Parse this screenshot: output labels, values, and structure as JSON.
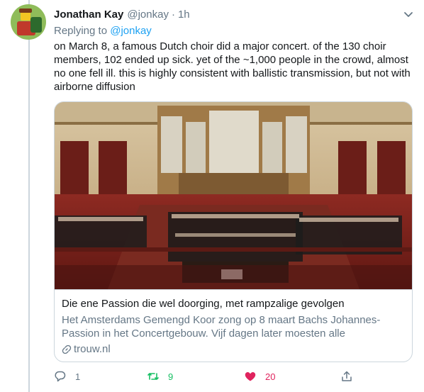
{
  "tweet": {
    "author_name": "Jonathan Kay",
    "author_handle": "@jonkay",
    "separator": "·",
    "time": "1h",
    "reply_prefix": "Replying to",
    "reply_to": "@jonkay",
    "text": "on March 8, a famous Dutch choir did a major concert. of the 130 choir members, 102 ended up sick. yet of the ~1,000 people in the crowd, almost no one fell ill. this is highly consistent with ballistic transmission, but not with airborne diffusion"
  },
  "card": {
    "title": "Die ene Passion die wel doorging, met rampzalige gevolgen",
    "description": "Het Amsterdams Gemengd Koor zong op 8 maart Bachs Johannes-Passion in het Concertgebouw. Vijf dagen later moesten alle concertzale…",
    "domain": "trouw.nl"
  },
  "actions": {
    "reply_count": "1",
    "retweet_count": "9",
    "like_count": "20"
  },
  "colors": {
    "accent": "#1da1f2",
    "retweet": "#17bf63",
    "like": "#e0245e",
    "muted": "#657786",
    "border": "#ccd6dd"
  },
  "icons": [
    "avatar",
    "chevron-down-icon",
    "link-icon",
    "reply-icon",
    "retweet-icon",
    "heart-icon",
    "share-icon"
  ]
}
